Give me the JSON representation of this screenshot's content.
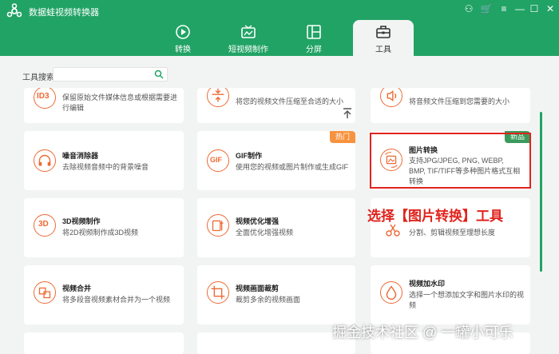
{
  "app": {
    "title": "数据蛙视频转换器"
  },
  "tabs": [
    {
      "label": "转换",
      "icon": "convert-icon"
    },
    {
      "label": "短视频制作",
      "icon": "short-video-icon"
    },
    {
      "label": "分屏",
      "icon": "split-screen-icon"
    },
    {
      "label": "工具",
      "icon": "toolbox-icon",
      "active": true
    }
  ],
  "search": {
    "label": "工具搜索:",
    "placeholder": ""
  },
  "cards": {
    "id3": {
      "title": "",
      "desc": "保留原始文件媒体信息或根据需要进行编辑",
      "icon_text": "ID3"
    },
    "compress_video": {
      "title": "",
      "desc": "将您的视频文件压缩至合适的大小"
    },
    "compress_audio": {
      "title": "",
      "desc": "将音频文件压缩到您需要的大小"
    },
    "denoise": {
      "title": "噪音消除器",
      "desc": "去除视频音频中的背景噪音"
    },
    "gif": {
      "title": "GIF制作",
      "desc": "使用您的视频或图片制作或生成GIF",
      "badge": "热门",
      "icon_text": "GIF"
    },
    "image_convert": {
      "title": "图片转换",
      "desc": "支持JPG/JPEG, PNG, WEBP, BMP, TIF/TIFF等多种图片格式互相转换",
      "badge": "新品"
    },
    "make_3d": {
      "title": "3D视频制作",
      "desc": "将2D视频制作成3D视频",
      "icon_text": "3D"
    },
    "enhance": {
      "title": "视频优化增强",
      "desc": "全面优化增强视频"
    },
    "trim": {
      "title": "",
      "desc": "分割、剪辑视频至理想长度"
    },
    "merge": {
      "title": "视频合并",
      "desc": "将多段音视频素材合并为一个视频"
    },
    "crop": {
      "title": "视频画面裁剪",
      "desc": "裁剪多余的视频画面"
    },
    "watermark": {
      "title": "视频加水印",
      "desc": "选择一个想添加文字和图片水印的视频"
    }
  },
  "annotation": "选择【图片转换】工具",
  "watermark": "掘金技术社区 @ 一罐小可乐",
  "colors": {
    "brand_green": "#21a365",
    "accent_orange": "#ee6a35",
    "annotation_red": "#e0231d",
    "hot_badge": "#f7933f",
    "new_badge": "#3a9a5b"
  }
}
